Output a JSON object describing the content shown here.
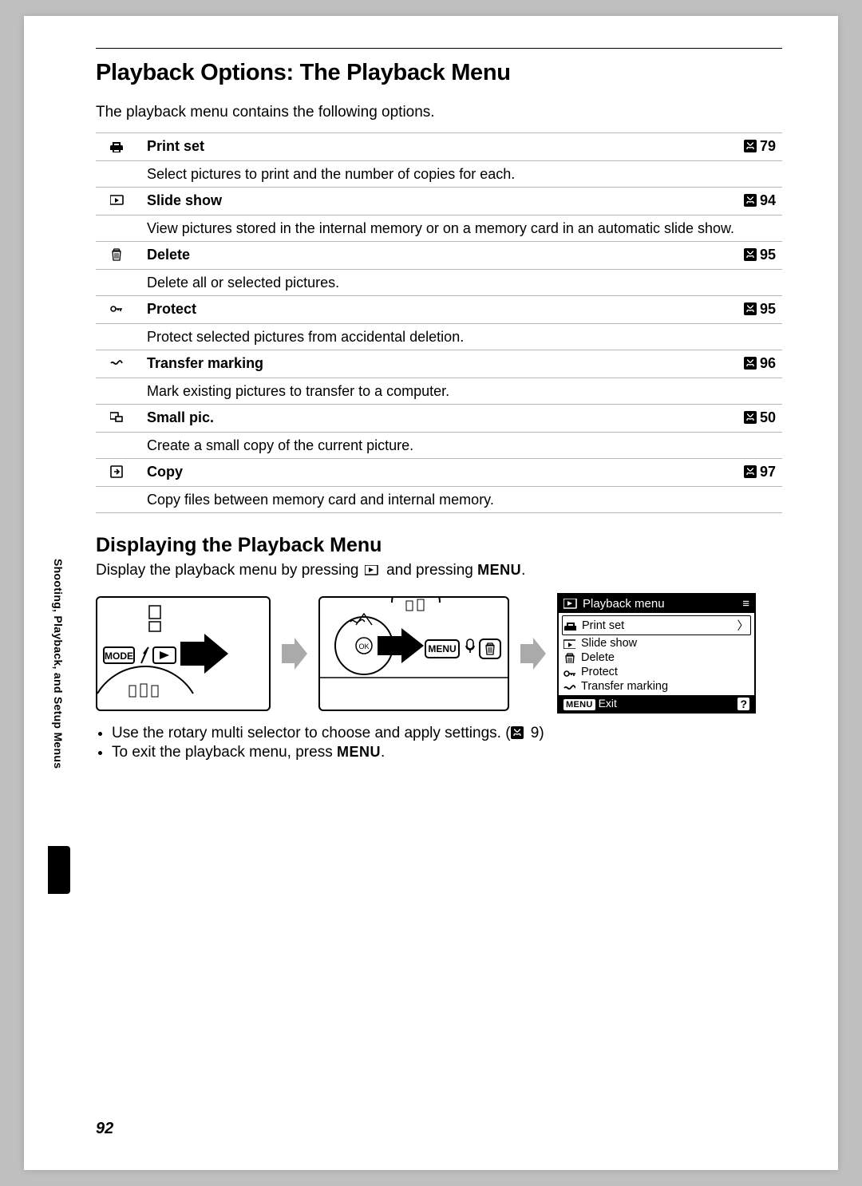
{
  "page": {
    "title": "Playback Options: The Playback Menu",
    "intro": "The playback menu contains the following options.",
    "side_tab": "Shooting, Playback, and Setup Menus",
    "number": "92"
  },
  "options": [
    {
      "icon": "print",
      "name": "Print set",
      "ref": "79",
      "desc": "Select pictures to print and the number of copies for each."
    },
    {
      "icon": "slide",
      "name": "Slide show",
      "ref": "94",
      "desc": "View pictures stored in the internal memory or on a memory card in an automatic slide show."
    },
    {
      "icon": "trash",
      "name": "Delete",
      "ref": "95",
      "desc": "Delete all or selected pictures."
    },
    {
      "icon": "key",
      "name": "Protect",
      "ref": "95",
      "desc": "Protect selected pictures from accidental deletion."
    },
    {
      "icon": "transfer",
      "name": "Transfer marking",
      "ref": "96",
      "desc": "Mark existing pictures to transfer to a computer."
    },
    {
      "icon": "smallpic",
      "name": "Small pic.",
      "ref": "50",
      "desc": "Create a small copy of the current picture."
    },
    {
      "icon": "copy",
      "name": "Copy",
      "ref": "97",
      "desc": "Copy files between memory card and internal memory."
    }
  ],
  "display": {
    "title": "Displaying the Playback Menu",
    "intro_pre": "Display the playback menu by pressing ",
    "intro_mid": " and pressing ",
    "intro_post": ".",
    "menu_word": "MENU",
    "screen_title": "Playback menu",
    "screen_items": [
      "Print set",
      "Slide show",
      "Delete",
      "Protect",
      "Transfer marking"
    ],
    "screen_exit": "Exit",
    "bullets": [
      {
        "text_pre": "Use the rotary multi selector to choose and apply settings. (",
        "ref": "9",
        "text_post": ")"
      },
      {
        "text_pre": "To exit the playback menu, press ",
        "menu": true,
        "text_post": "."
      }
    ]
  }
}
